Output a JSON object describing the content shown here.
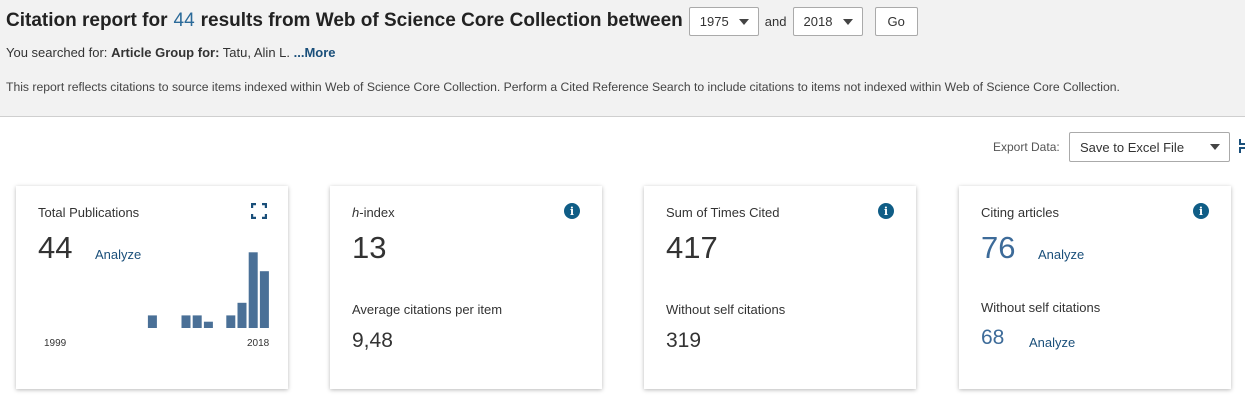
{
  "header": {
    "title_prefix": "Citation report for",
    "result_count": "44",
    "title_suffix": "results from Web of Science Core Collection between",
    "year_from": "1975",
    "and_label": "and",
    "year_to": "2018",
    "go_label": "Go",
    "searched_prefix": "You searched for:",
    "searched_field": "Article Group for:",
    "searched_value": "Tatu, Alin L.",
    "more_label": "...More",
    "note": "This report reflects citations to source items indexed within Web of Science Core Collection. Perform a Cited Reference Search to include citations to items not indexed within Web of Science Core Collection."
  },
  "export": {
    "label": "Export Data:",
    "selected": "Save to Excel File"
  },
  "cards": {
    "publications": {
      "label": "Total Publications",
      "value": "44",
      "analyze": "Analyze",
      "axis_start": "1999",
      "axis_end": "2018"
    },
    "hindex": {
      "label_italic": "h",
      "label_rest": "-index",
      "value": "13",
      "sub_label": "Average citations per item",
      "sub_value": "9,48"
    },
    "times_cited": {
      "label": "Sum of Times Cited",
      "value": "417",
      "sub_label": "Without self citations",
      "sub_value": "319"
    },
    "citing": {
      "label": "Citing articles",
      "value": "76",
      "analyze": "Analyze",
      "sub_label": "Without self citations",
      "sub_value": "68",
      "sub_analyze": "Analyze"
    }
  },
  "colors": {
    "accent": "#3d6b99",
    "bar": "#4a7097",
    "info": "#0f5d86"
  },
  "icons": [
    "expand-icon",
    "info-icon",
    "chevron-down-icon"
  ],
  "chart_data": {
    "type": "bar",
    "categories": [
      "1999",
      "2000",
      "2001",
      "2002",
      "2003",
      "2004",
      "2005",
      "2006",
      "2007",
      "2008",
      "2009",
      "2010",
      "2011",
      "2012",
      "2013",
      "2014",
      "2015",
      "2016",
      "2017",
      "2018"
    ],
    "values": [
      0,
      0,
      0,
      0,
      0,
      0,
      0,
      0,
      0,
      1,
      0,
      0,
      1,
      1,
      0.5,
      0,
      1,
      2,
      6,
      4.5
    ],
    "ylim": [
      0,
      6.5
    ],
    "xlabel": "",
    "ylabel": ""
  }
}
